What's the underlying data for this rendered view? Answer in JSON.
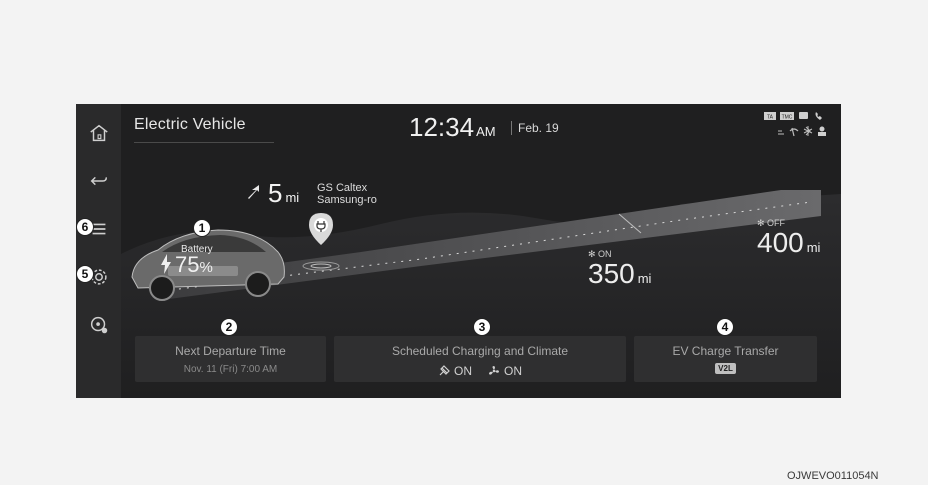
{
  "header": {
    "title": "Electric Vehicle",
    "time": "12:34",
    "ampm": "AM",
    "date": "Feb. 19"
  },
  "status_icons": [
    "TA",
    "TMC",
    "message-icon",
    "phone-icon",
    "signal-icon",
    "wireless-icon",
    "bluetooth-icon",
    "user-icon"
  ],
  "navigation": {
    "distance": "5",
    "distance_unit": "mi",
    "station_line1": "GS Caltex",
    "station_line2": "Samsung-ro"
  },
  "battery": {
    "label": "Battery",
    "percent": "75",
    "percent_sign": "%"
  },
  "range_ac_on": {
    "mode": "ON",
    "value": "350",
    "unit": "mi"
  },
  "range_ac_off": {
    "mode": "OFF",
    "value": "400",
    "unit": "mi"
  },
  "cards": {
    "departure": {
      "title": "Next Departure Time",
      "subtitle": "Nov. 11 (Fri) 7:00 AM"
    },
    "scheduled": {
      "title": "Scheduled Charging and Climate",
      "charge_status": "ON",
      "climate_status": "ON"
    },
    "transfer": {
      "title": "EV Charge Transfer",
      "badge": "V2L"
    }
  },
  "callouts": [
    "1",
    "2",
    "3",
    "4",
    "5",
    "6"
  ],
  "image_code": "OJWEVO011054N",
  "colors": {
    "screen_bg": "#1f1f20",
    "sidebar_bg": "#2a2a2b",
    "card_bg": "#2f2f30",
    "text": "#ededed"
  }
}
